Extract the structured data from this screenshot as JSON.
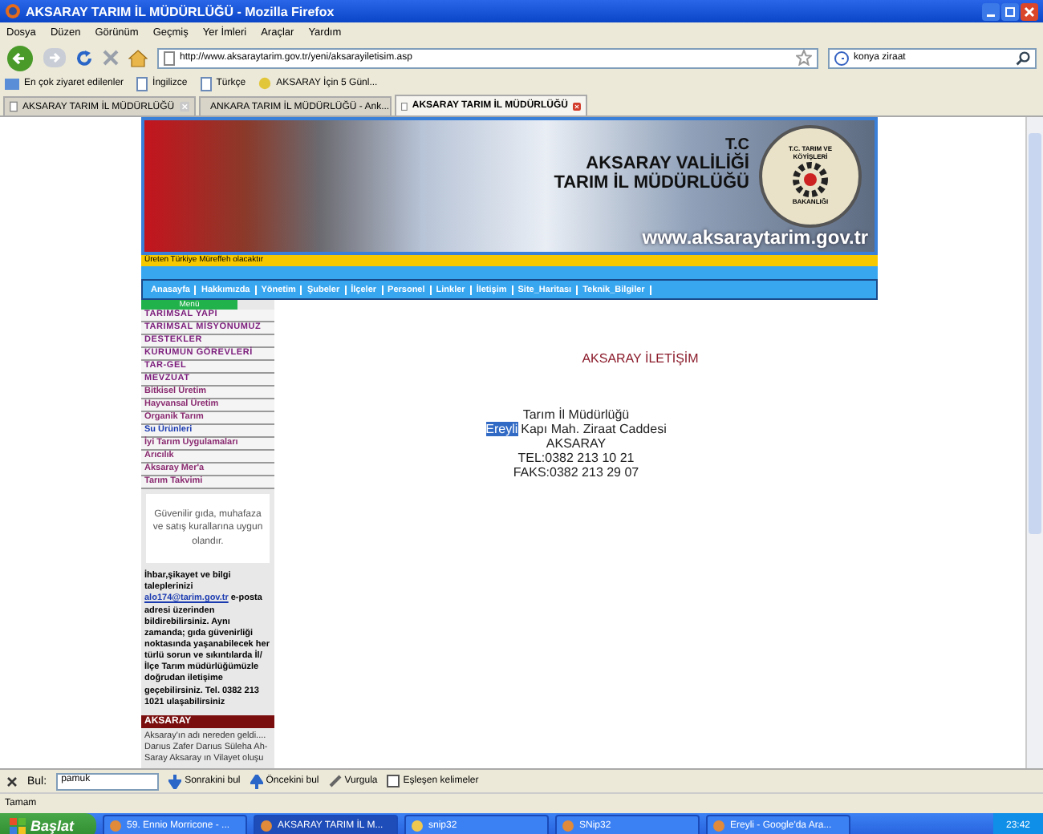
{
  "window": {
    "title": "AKSARAY TARIM İL MÜDÜRLÜĞÜ - Mozilla Firefox"
  },
  "menu_bar": [
    "Dosya",
    "Düzen",
    "Görünüm",
    "Geçmiş",
    "Yer İmleri",
    "Araçlar",
    "Yardım"
  ],
  "toolbar": {
    "url": "http://www.aksaraytarim.gov.tr/yeni/aksarayiletisim.asp",
    "search_value": "konya ziraat"
  },
  "bookmarks": [
    "En çok ziyaret edilenler",
    "İngilizce",
    "Türkçe",
    "AKSARAY İçin 5 Günl..."
  ],
  "tabs": [
    {
      "label": "AKSARAY TARIM İL MÜDÜRLÜĞÜ",
      "selected": false
    },
    {
      "label": "ANKARA TARIM İL MÜDÜRLÜĞÜ - Ank...",
      "selected": false
    },
    {
      "label": "AKSARAY TARIM İL MÜDÜRLÜĞÜ",
      "selected": true
    }
  ],
  "site": {
    "banner": {
      "line_1": "T.C",
      "line_2": "AKSARAY VALİLİĞİ",
      "line_3": "TARIM İL MÜDÜRLÜĞÜ",
      "web_address": "www.aksaraytarim.gov.tr",
      "emblem_top": "T.C. TARIM VE KÖYİŞLERİ",
      "emblem_bottom": "BAKANLIĞI"
    },
    "ticker": "Üreten Türkiye Müreffeh olacaktır",
    "nav": [
      "Anasayfa",
      "Hakkımızda",
      "Yönetim",
      "Şubeler",
      "İlçeler",
      "Personel",
      "Linkler",
      "İletişim",
      "Site_Haritası",
      "Teknik_Bilgiler"
    ],
    "menu_label": "Menü",
    "sidebar": [
      {
        "label": "TARIMSAL YAPI",
        "kind": "heading",
        "highlighted": false
      },
      {
        "label": "TARIMSAL MİSYONUMUZ",
        "kind": "heading",
        "highlighted": false
      },
      {
        "label": "DESTEKLER",
        "kind": "heading",
        "highlighted": false
      },
      {
        "label": "KURUMUN GÖREVLERİ",
        "kind": "heading",
        "highlighted": false
      },
      {
        "label": "TAR-GEL",
        "kind": "heading",
        "highlighted": false
      },
      {
        "label": "MEVZUAT",
        "kind": "heading",
        "highlighted": false
      },
      {
        "label": "Bitkisel Üretim",
        "kind": "item",
        "highlighted": false
      },
      {
        "label": "Hayvansal Üretim",
        "kind": "item",
        "highlighted": false
      },
      {
        "label": "Organik Tarım",
        "kind": "item",
        "highlighted": false
      },
      {
        "label": "Su Ürünleri",
        "kind": "item",
        "highlighted": true
      },
      {
        "label": "İyi Tarım Uygulamaları",
        "kind": "item",
        "highlighted": false
      },
      {
        "label": "Arıcılık",
        "kind": "item",
        "highlighted": false
      },
      {
        "label": "Aksaray Mer'a",
        "kind": "item",
        "highlighted": false
      },
      {
        "label": "Tarım Takvimi",
        "kind": "item",
        "highlighted": false
      }
    ],
    "notice": "Güvenilir gıda, muhafaza ve satış kurallarına uygun olandır.",
    "complaint": {
      "before": "İhbar,şikayet ve bilgi taleplerinizi",
      "link": "alo174@tarim.gov.tr",
      "after": "e-posta adresi üzerinden bildirebilirsiniz. Aynı zamanda; gıda güvenirliği noktasında yaşanabilecek her türlü sorun ve sıkıntılarda İl/İlçe Tarım müdürlüğümüzle doğrudan iletişime geçebilirsiniz. Tel. 0382 213 1021 ulaşabilirsiniz"
    },
    "section_heading": "AKSARAY",
    "section_text": "Aksaray'ın adı nereden geldi.... Darıus Zafer Darıus Süleha Ah-Saray Aksaray ın Vilayet oluşu",
    "content": {
      "title": "AKSARAY İLETİŞİM",
      "lines": [
        {
          "text": "Tarım İl Müdürlüğü"
        },
        {
          "highlight": "Ereyli",
          "text": "Kapı Mah. Ziraat Caddesi"
        },
        {
          "text": "AKSARAY"
        },
        {
          "text": "TEL:0382 213 10 21"
        },
        {
          "text": "FAKS:0382 213 29 07"
        }
      ]
    }
  },
  "find_bar": {
    "label": "Bul:",
    "value": "pamuk",
    "buttons": [
      "Sonrakini bul",
      "Öncekini bul",
      "Vurgula"
    ],
    "match_case": {
      "label": "Eşleşen kelimeler",
      "checked": false
    }
  },
  "status_bar": "Tamam",
  "taskbar": {
    "start": "Başlat",
    "tasks": [
      {
        "label": "59. Ennio Morricone - ...",
        "selected": false
      },
      {
        "label": "AKSARAY TARIM İL M...",
        "selected": true
      },
      {
        "label": "snip32",
        "selected": false
      },
      {
        "label": "SNip32",
        "selected": false
      },
      {
        "label": "Ereyli - Google'da Ara...",
        "selected": false
      }
    ],
    "clock": "23:42"
  }
}
